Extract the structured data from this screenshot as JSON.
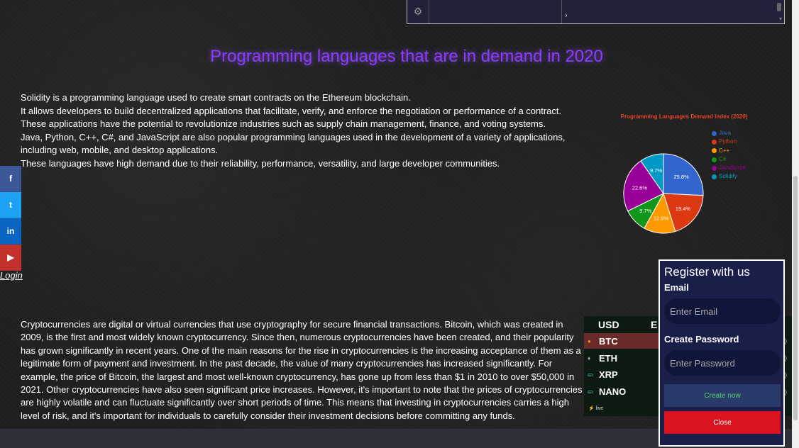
{
  "page_title": "Programming languages that are in demand in 2020",
  "intro_paragraphs": [
    "Solidity is a programming language used to create smart contracts on the Ethereum blockchain.",
    "It allows developers to build decentralized applications that facilitate, verify, and enforce the negotiation or performance of a contract.",
    "These applications have the potential to revolutionize industries such as supply chain management, finance, and voting systems. Java, Python, C++, C#, and JavaScript are also popular programming languages used in the development of a variety of applications, including web, mobile, and desktop applications.",
    "These languages have high demand due to their reliability, performance, versatility, and large developer communities."
  ],
  "crypto_text": "Cryptocurrencies are digital or virtual currencies that use cryptography for secure financial transactions. Bitcoin, which was created in 2009, is the first and most widely known cryptocurrency. Since then, numerous cryptocurrencies have been created, and their popularity has grown significantly in recent years. One of the main reasons for the rise in cryptocurrencies is the increasing acceptance of them as a legitimate form of payment and investment. In the past decade, the value of many cryptocurrencies has increased significantly. For example, the price of Bitcoin, the largest and most well-known cryptocurrency, has gone up from less than $1 in 2010 to over $50,000 in 2021. Other cryptocurrencies have also seen significant price increases. However, it's important to note that the prices of cryptocurrencies are highly volatile and can fluctuate significantly over short periods of time. This means that investing in cryptocurrencies carries a high level of risk, and it's important for individuals to carefully consider their investment decisions before committing any funds.",
  "social": {
    "facebook": "f",
    "twitter": "t",
    "linkedin": "in",
    "youtube": "▶"
  },
  "login_label": "Login",
  "ticker": {
    "currency": "USD",
    "second_header": "E",
    "rows": [
      {
        "symbol": "BTC",
        "icon": "●"
      },
      {
        "symbol": "ETH",
        "icon": "♦"
      },
      {
        "symbol": "XRP",
        "icon": "▭"
      },
      {
        "symbol": "NANO",
        "icon": "▭"
      }
    ],
    "live_label": "live"
  },
  "register": {
    "title": "Register with us",
    "email_label": "Email",
    "email_placeholder": "Enter Email",
    "password_label": "Create Password",
    "password_placeholder": "Enter Password",
    "create_label": "Create now",
    "close_label": "Close"
  },
  "chart_data": {
    "type": "pie",
    "title": "Programming Languages Demand Index (2020)",
    "legend_position": "right",
    "categories": [
      "Java",
      "Python",
      "C++",
      "C#",
      "JavaScript",
      "Solidity"
    ],
    "values": [
      25.8,
      19.4,
      12.9,
      9.7,
      22.6,
      9.7
    ],
    "labels": [
      "25.8%",
      "19.4%",
      "12.9%",
      "9.7%",
      "22.6%",
      "9.7%"
    ],
    "colors": [
      "#3366cc",
      "#dc3912",
      "#ff9900",
      "#109618",
      "#990099",
      "#0099c6"
    ]
  },
  "colors": {
    "title": "#8a3cff",
    "register_bg": "#1a1f4a",
    "close_button": "#d9141e"
  }
}
